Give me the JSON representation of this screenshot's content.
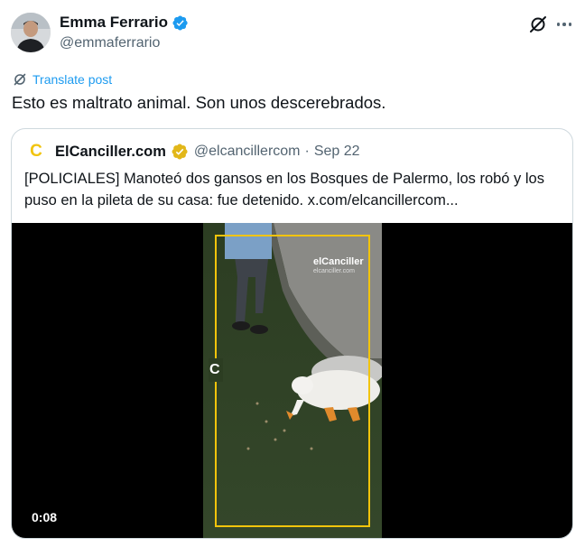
{
  "author": {
    "name": "Emma Ferrario",
    "handle": "@emmaferrario"
  },
  "icons": {
    "verified": "verified-badge-icon",
    "grok": "grok-icon",
    "more": "more-icon",
    "translate": "translate-icon",
    "gold_verified": "gold-verified-icon"
  },
  "translate_label": "Translate post",
  "tweet_text": "Esto es maltrato animal. Son unos descerebrados.",
  "quote": {
    "logo_letter": "C",
    "name": "ElCanciller.com",
    "handle": "@elcancillercom",
    "separator": "·",
    "date": "Sep 22",
    "text": "[POLICIALES] Manoteó dos gansos en los Bosques de Palermo, los robó y los puso en la pileta de su casa: fue detenido.  x.com/elcancillercom...",
    "video": {
      "duration": "0:08",
      "watermark_brand": "elCanciller",
      "watermark_handle": "elcanciller.com",
      "frame_letter": "C"
    }
  },
  "colors": {
    "link_blue": "#1d9bf0",
    "gold": "#e2b719",
    "frame_yellow": "#f2c40b"
  }
}
